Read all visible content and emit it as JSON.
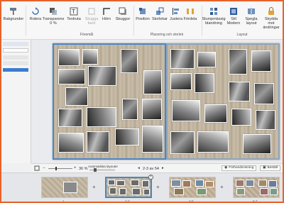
{
  "ribbon": {
    "buttons": {
      "bakgrunder": "Bakgrunder",
      "rotera": "Rotera",
      "transparens": "Transparens",
      "transparens_value": "0 %",
      "textruta": "Textruta",
      "skugga_kant": "Skugga kant",
      "hörn": "Hörn",
      "skuggor": "Skuggor",
      "position": "Position",
      "storlekar": "Storlekar",
      "justera": "Justera",
      "fördela": "Fördela",
      "slumpmässig": "Slumpmässig blandning",
      "stil": "Stil Modern",
      "spegla": "Spegla layout",
      "skydda": "Skydda mot ändringar"
    },
    "groups": {
      "foremal": "Föremål",
      "placering": "Placering och storlek",
      "layout": "Layout"
    }
  },
  "zoombar": {
    "zoom_value": "36 %",
    "auto_layout": "Automatiska layouter",
    "page_indicator": "2-3 av 54",
    "preview_label": "Förhandsvisning",
    "order_label": "Beställ"
  },
  "thumbs": {
    "labels": [
      "1",
      "2-3",
      "4-5",
      "6-7"
    ]
  },
  "icons": {
    "accent": "#4a86c5",
    "window_border": "#e8622a"
  }
}
